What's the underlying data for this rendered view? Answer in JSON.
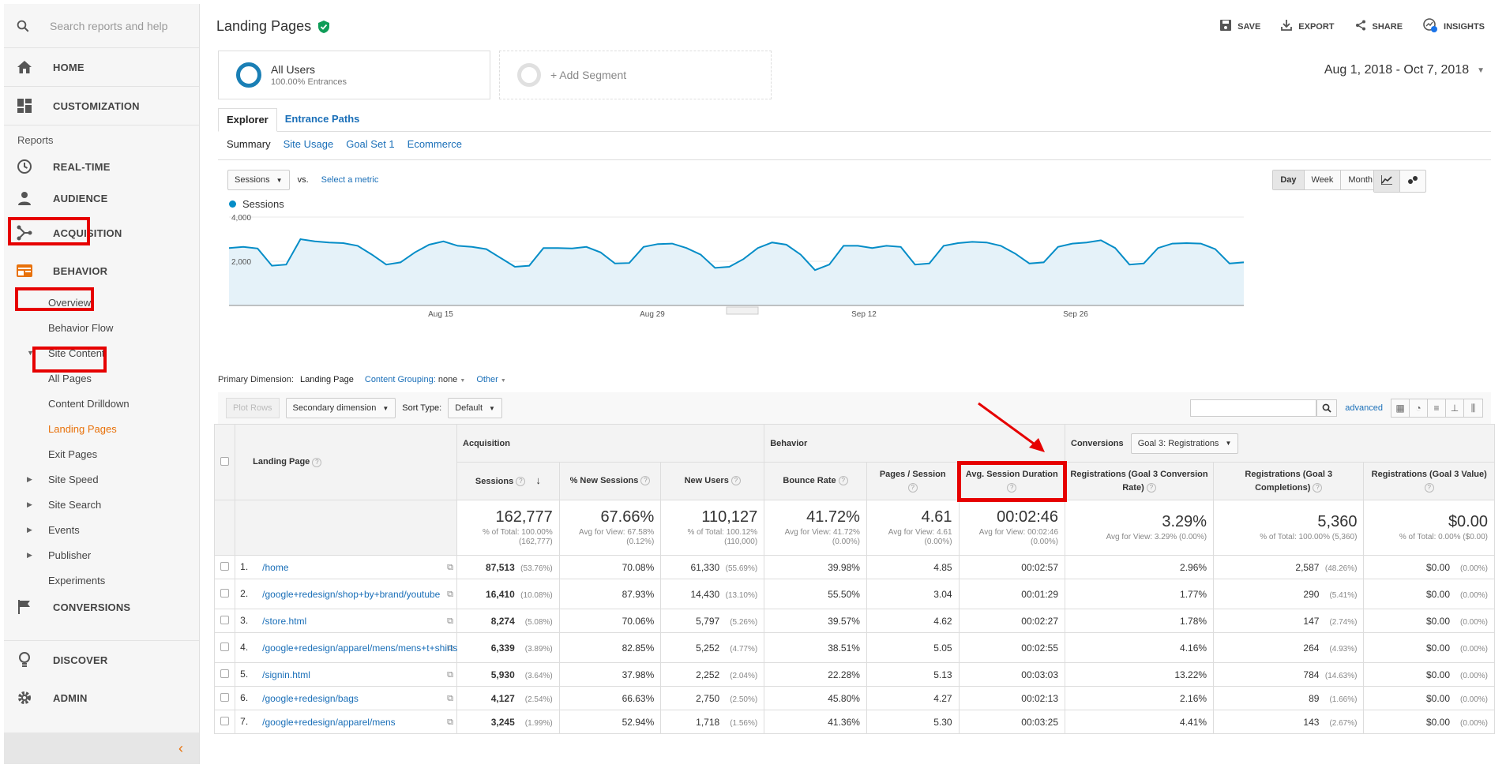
{
  "sidebar": {
    "search_placeholder": "Search reports and help",
    "home": "HOME",
    "customization": "CUSTOMIZATION",
    "reports_heading": "Reports",
    "realtime": "REAL-TIME",
    "audience": "AUDIENCE",
    "acquisition": "ACQUISITION",
    "behavior": "BEHAVIOR",
    "behavior_items": [
      "Overview",
      "Behavior Flow"
    ],
    "site_content": "Site Content",
    "site_content_items": [
      "All Pages",
      "Content Drilldown",
      "Landing Pages",
      "Exit Pages"
    ],
    "more_items": [
      "Site Speed",
      "Site Search",
      "Events",
      "Publisher"
    ],
    "experiments": "Experiments",
    "conversions": "CONVERSIONS",
    "discover": "DISCOVER",
    "admin": "ADMIN"
  },
  "header": {
    "title": "Landing Pages",
    "save": "SAVE",
    "export": "EXPORT",
    "share": "SHARE",
    "insights": "INSIGHTS"
  },
  "segments": {
    "all_users": "All Users",
    "all_users_sub": "100.00% Entrances",
    "add_segment": "+ Add Segment"
  },
  "date_range": "Aug 1, 2018 - Oct 7, 2018",
  "tabs": [
    "Explorer",
    "Entrance Paths"
  ],
  "subtabs": [
    "Summary",
    "Site Usage",
    "Goal Set 1",
    "Ecommerce"
  ],
  "chart_controls": {
    "metric": "Sessions",
    "vs": "vs.",
    "select_metric": "Select a metric",
    "periods": [
      "Day",
      "Week",
      "Month"
    ],
    "legend": "Sessions"
  },
  "chart_data": {
    "type": "area",
    "series": [
      {
        "name": "Sessions",
        "values": [
          2600,
          2650,
          2580,
          1800,
          1850,
          3000,
          2900,
          2850,
          2820,
          2700,
          2300,
          1850,
          1950,
          2400,
          2750,
          2900,
          2700,
          2650,
          2550,
          2150,
          1750,
          1800,
          2600,
          2600,
          2580,
          2650,
          2400,
          1900,
          1920,
          2650,
          2780,
          2800,
          2600,
          2300,
          1700,
          1750,
          2100,
          2600,
          2850,
          2750,
          2300,
          1600,
          1850,
          2700,
          2700,
          2600,
          2700,
          2650,
          1850,
          1900,
          2700,
          2820,
          2880,
          2850,
          2700,
          2350,
          1900,
          1950,
          2650,
          2800,
          2850,
          2950,
          2600,
          1850,
          1900,
          2600,
          2800,
          2820,
          2800,
          2550,
          1900,
          1950
        ]
      }
    ],
    "ylim": [
      0,
      4000
    ],
    "yticks": [
      "4,000",
      "2,000"
    ],
    "xticks": [
      "Aug 15",
      "Aug 29",
      "Sep 12",
      "Sep 26"
    ],
    "color": "#058dc7"
  },
  "primary_dimension": {
    "label": "Primary Dimension:",
    "value": "Landing Page",
    "grouping": "Content Grouping:",
    "grouping_value": "none",
    "other": "Other"
  },
  "table_controls": {
    "plot_rows": "Plot Rows",
    "secondary_dimension": "Secondary dimension",
    "sort_type_label": "Sort Type:",
    "sort_type": "Default",
    "advanced": "advanced"
  },
  "table": {
    "group_headers": {
      "landing_page": "Landing Page",
      "acquisition": "Acquisition",
      "behavior": "Behavior",
      "conversions": "Conversions",
      "goal_select": "Goal 3: Registrations"
    },
    "columns": [
      "Sessions",
      "% New Sessions",
      "New Users",
      "Bounce Rate",
      "Pages / Session",
      "Avg. Session Duration",
      "Registrations (Goal 3 Conversion Rate)",
      "Registrations (Goal 3 Completions)",
      "Registrations (Goal 3 Value)"
    ],
    "totals": [
      {
        "big": "162,777",
        "sub": "% of Total: 100.00% (162,777)"
      },
      {
        "big": "67.66%",
        "sub": "Avg for View: 67.58% (0.12%)"
      },
      {
        "big": "110,127",
        "sub": "% of Total: 100.12% (110,000)"
      },
      {
        "big": "41.72%",
        "sub": "Avg for View: 41.72% (0.00%)"
      },
      {
        "big": "4.61",
        "sub": "Avg for View: 4.61 (0.00%)"
      },
      {
        "big": "00:02:46",
        "sub": "Avg for View: 00:02:46 (0.00%)"
      },
      {
        "big": "3.29%",
        "sub": "Avg for View: 3.29% (0.00%)"
      },
      {
        "big": "5,360",
        "sub": "% of Total: 100.00% (5,360)"
      },
      {
        "big": "$0.00",
        "sub": "% of Total: 0.00% ($0.00)"
      }
    ],
    "rows": [
      {
        "n": "1.",
        "page": "/home",
        "sessions": "87,513",
        "sessions_pct": "(53.76%)",
        "new_sessions": "70.08%",
        "new_users": "61,330",
        "new_users_pct": "(55.69%)",
        "bounce": "39.98%",
        "pps": "4.85",
        "dur": "00:02:57",
        "conv": "2.96%",
        "comp": "2,587",
        "comp_pct": "(48.26%)",
        "value": "$0.00",
        "value_pct": "(0.00%)"
      },
      {
        "n": "2.",
        "page": "/google+redesign/shop+by+brand/youtube",
        "sessions": "16,410",
        "sessions_pct": "(10.08%)",
        "new_sessions": "87.93%",
        "new_users": "14,430",
        "new_users_pct": "(13.10%)",
        "bounce": "55.50%",
        "pps": "3.04",
        "dur": "00:01:29",
        "conv": "1.77%",
        "comp": "290",
        "comp_pct": "(5.41%)",
        "value": "$0.00",
        "value_pct": "(0.00%)"
      },
      {
        "n": "3.",
        "page": "/store.html",
        "sessions": "8,274",
        "sessions_pct": "(5.08%)",
        "new_sessions": "70.06%",
        "new_users": "5,797",
        "new_users_pct": "(5.26%)",
        "bounce": "39.57%",
        "pps": "4.62",
        "dur": "00:02:27",
        "conv": "1.78%",
        "comp": "147",
        "comp_pct": "(2.74%)",
        "value": "$0.00",
        "value_pct": "(0.00%)"
      },
      {
        "n": "4.",
        "page": "/google+redesign/apparel/mens/mens+t+shirts",
        "sessions": "6,339",
        "sessions_pct": "(3.89%)",
        "new_sessions": "82.85%",
        "new_users": "5,252",
        "new_users_pct": "(4.77%)",
        "bounce": "38.51%",
        "pps": "5.05",
        "dur": "00:02:55",
        "conv": "4.16%",
        "comp": "264",
        "comp_pct": "(4.93%)",
        "value": "$0.00",
        "value_pct": "(0.00%)"
      },
      {
        "n": "5.",
        "page": "/signin.html",
        "sessions": "5,930",
        "sessions_pct": "(3.64%)",
        "new_sessions": "37.98%",
        "new_users": "2,252",
        "new_users_pct": "(2.04%)",
        "bounce": "22.28%",
        "pps": "5.13",
        "dur": "00:03:03",
        "conv": "13.22%",
        "comp": "784",
        "comp_pct": "(14.63%)",
        "value": "$0.00",
        "value_pct": "(0.00%)"
      },
      {
        "n": "6.",
        "page": "/google+redesign/bags",
        "sessions": "4,127",
        "sessions_pct": "(2.54%)",
        "new_sessions": "66.63%",
        "new_users": "2,750",
        "new_users_pct": "(2.50%)",
        "bounce": "45.80%",
        "pps": "4.27",
        "dur": "00:02:13",
        "conv": "2.16%",
        "comp": "89",
        "comp_pct": "(1.66%)",
        "value": "$0.00",
        "value_pct": "(0.00%)"
      },
      {
        "n": "7.",
        "page": "/google+redesign/apparel/mens",
        "sessions": "3,245",
        "sessions_pct": "(1.99%)",
        "new_sessions": "52.94%",
        "new_users": "1,718",
        "new_users_pct": "(1.56%)",
        "bounce": "41.36%",
        "pps": "5.30",
        "dur": "00:03:25",
        "conv": "4.41%",
        "comp": "143",
        "comp_pct": "(2.67%)",
        "value": "$0.00",
        "value_pct": "(0.00%)"
      }
    ]
  },
  "colors": {
    "accent": "#1a6fb8",
    "highlight": "#e60000",
    "active_nav": "#e8710a"
  }
}
